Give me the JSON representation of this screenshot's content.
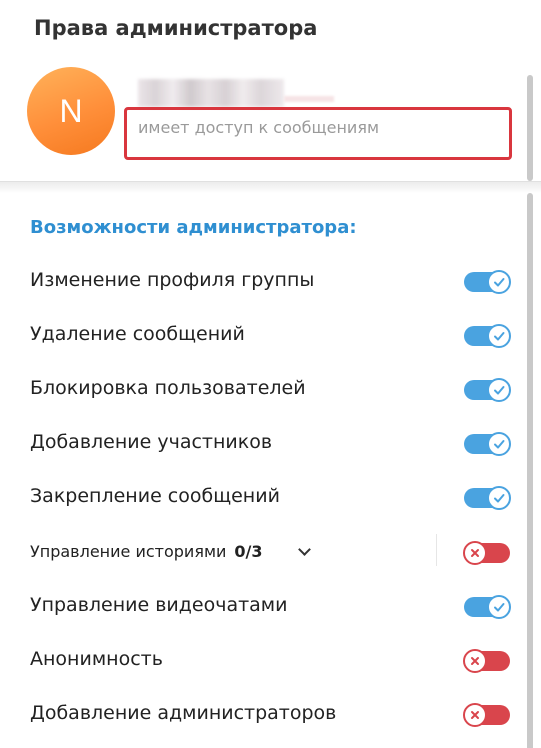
{
  "header": {
    "title": "Права администратора"
  },
  "user": {
    "avatar_letter": "N",
    "status": "имеет доступ к сообщениям",
    "avatar_color": "#ff8f3a"
  },
  "section": {
    "title": "Возможности администратора:"
  },
  "permissions": [
    {
      "label": "Изменение профиля группы",
      "enabled": true
    },
    {
      "label": "Удаление сообщений",
      "enabled": true
    },
    {
      "label": "Блокировка пользователей",
      "enabled": true
    },
    {
      "label": "Добавление участников",
      "enabled": true
    },
    {
      "label": "Закрепление сообщений",
      "enabled": true
    },
    {
      "label": "Управление историями",
      "count": "0/3",
      "enabled": false
    },
    {
      "label": "Управление видеочатами",
      "enabled": true
    },
    {
      "label": "Анонимность",
      "enabled": false
    },
    {
      "label": "Добавление администраторов",
      "enabled": false
    }
  ],
  "colors": {
    "accent": "#2f8fd1",
    "toggle_on": "#4aa3e0",
    "toggle_off": "#d9454c",
    "highlight": "#d9363e"
  }
}
